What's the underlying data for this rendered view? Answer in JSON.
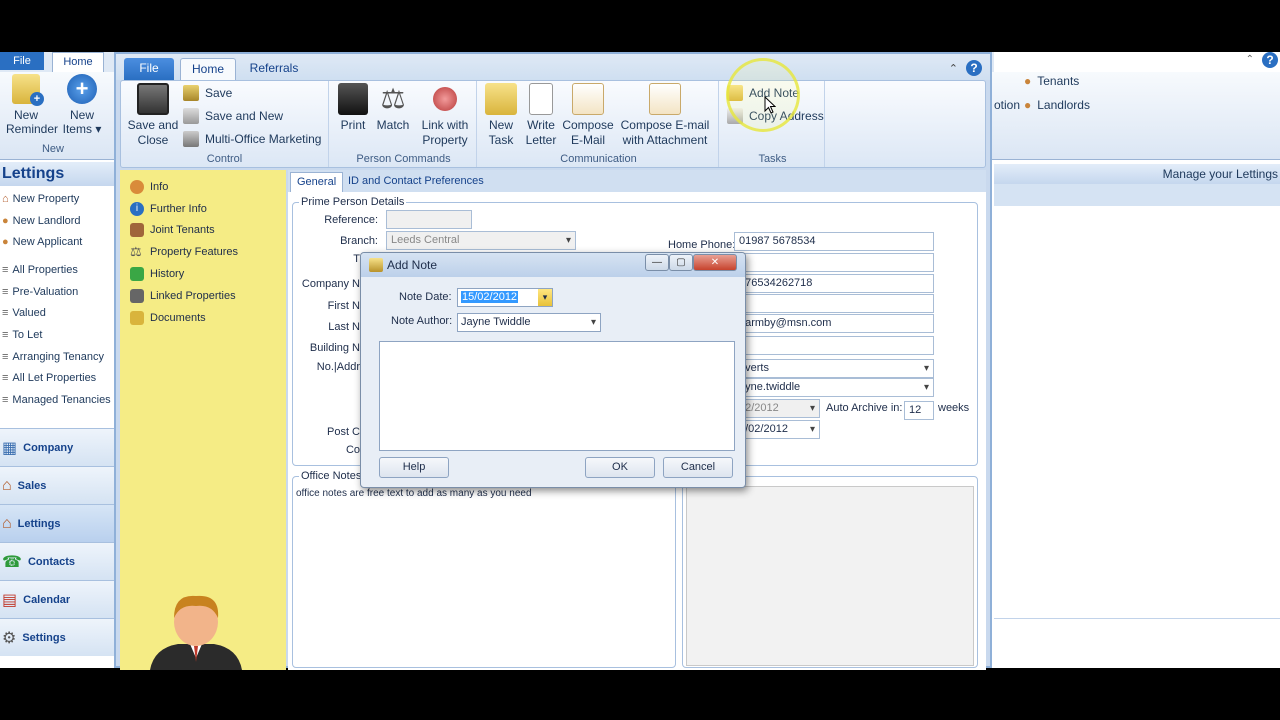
{
  "back_window": {
    "tab_file": "File",
    "tab_home": "Home",
    "new_reminder": "New\nReminder",
    "new_items": "New\nItems ▾",
    "group_new": "New",
    "nav_title": "Lettings",
    "nav_items": [
      "New Property",
      "New Landlord",
      "New Applicant",
      "All Properties",
      "Pre-Valuation",
      "Valued",
      "To Let",
      "Arranging Tenancy",
      "All Let Properties",
      "Managed Tenancies"
    ],
    "modules": [
      "Company",
      "Sales",
      "Lettings",
      "Contacts",
      "Calendar",
      "Settings"
    ],
    "right_partial": "otion",
    "right_tenants": "Tenants",
    "right_landlords": "Landlords",
    "manage": "Manage your Lettings"
  },
  "tabs": {
    "file": "File",
    "home": "Home",
    "referrals": "Referrals"
  },
  "ribbon": {
    "control": {
      "label": "Control",
      "save_and_close": "Save and\nClose",
      "save": "Save",
      "save_and_new": "Save and New",
      "multi_office": "Multi-Office Marketing"
    },
    "person_commands": {
      "label": "Person Commands",
      "print": "Print",
      "match": "Match",
      "link_with_property": "Link with\nProperty"
    },
    "communication": {
      "label": "Communication",
      "new_task": "New\nTask",
      "write_letter": "Write\nLetter",
      "compose_email": "Compose\nE-Mail",
      "compose_email_attachment": "Compose E-mail\nwith Attachment"
    },
    "tasks": {
      "label": "Tasks",
      "add_note": "Add Note",
      "copy_address": "Copy Address"
    }
  },
  "left_panel": {
    "items": [
      "Info",
      "Further Info",
      "Joint Tenants",
      "Property Features",
      "History",
      "Linked Properties",
      "Documents"
    ]
  },
  "content": {
    "tabs": [
      "General",
      "ID and Contact Preferences"
    ],
    "prime_person_legend": "Prime Person Details",
    "labels": {
      "reference": "Reference:",
      "branch": "Branch:",
      "t": "T",
      "company": "Company N",
      "first": "First N",
      "last": "Last N",
      "building": "Building N",
      "no_address": "No.|Addr",
      "post": "Post C",
      "country": "Co",
      "home_phone": "Home Phone:",
      "auto_archive": "Auto Archive in:",
      "weeks": "weeks"
    },
    "values": {
      "branch": "Leeds Central",
      "home_phone": "01987 5678534",
      "mobile": "776534262718",
      "email": "barmby@msn.com",
      "source": "dverts",
      "negotiator": "ayne.twiddle",
      "date1": "02/2012",
      "date2": "2/02/2012",
      "auto_archive": "12"
    },
    "office_notes_legend": "Office Notes",
    "office_notes_text": "office notes are free text to add as many as you need",
    "other_notes_legend": "es"
  },
  "dialog": {
    "title": "Add Note",
    "note_date_label": "Note Date:",
    "note_date_value": "15/02/2012",
    "note_author_label": "Note Author:",
    "note_author_value": "Jayne Twiddle",
    "note_text": "",
    "help": "Help",
    "ok": "OK",
    "cancel": "Cancel"
  }
}
